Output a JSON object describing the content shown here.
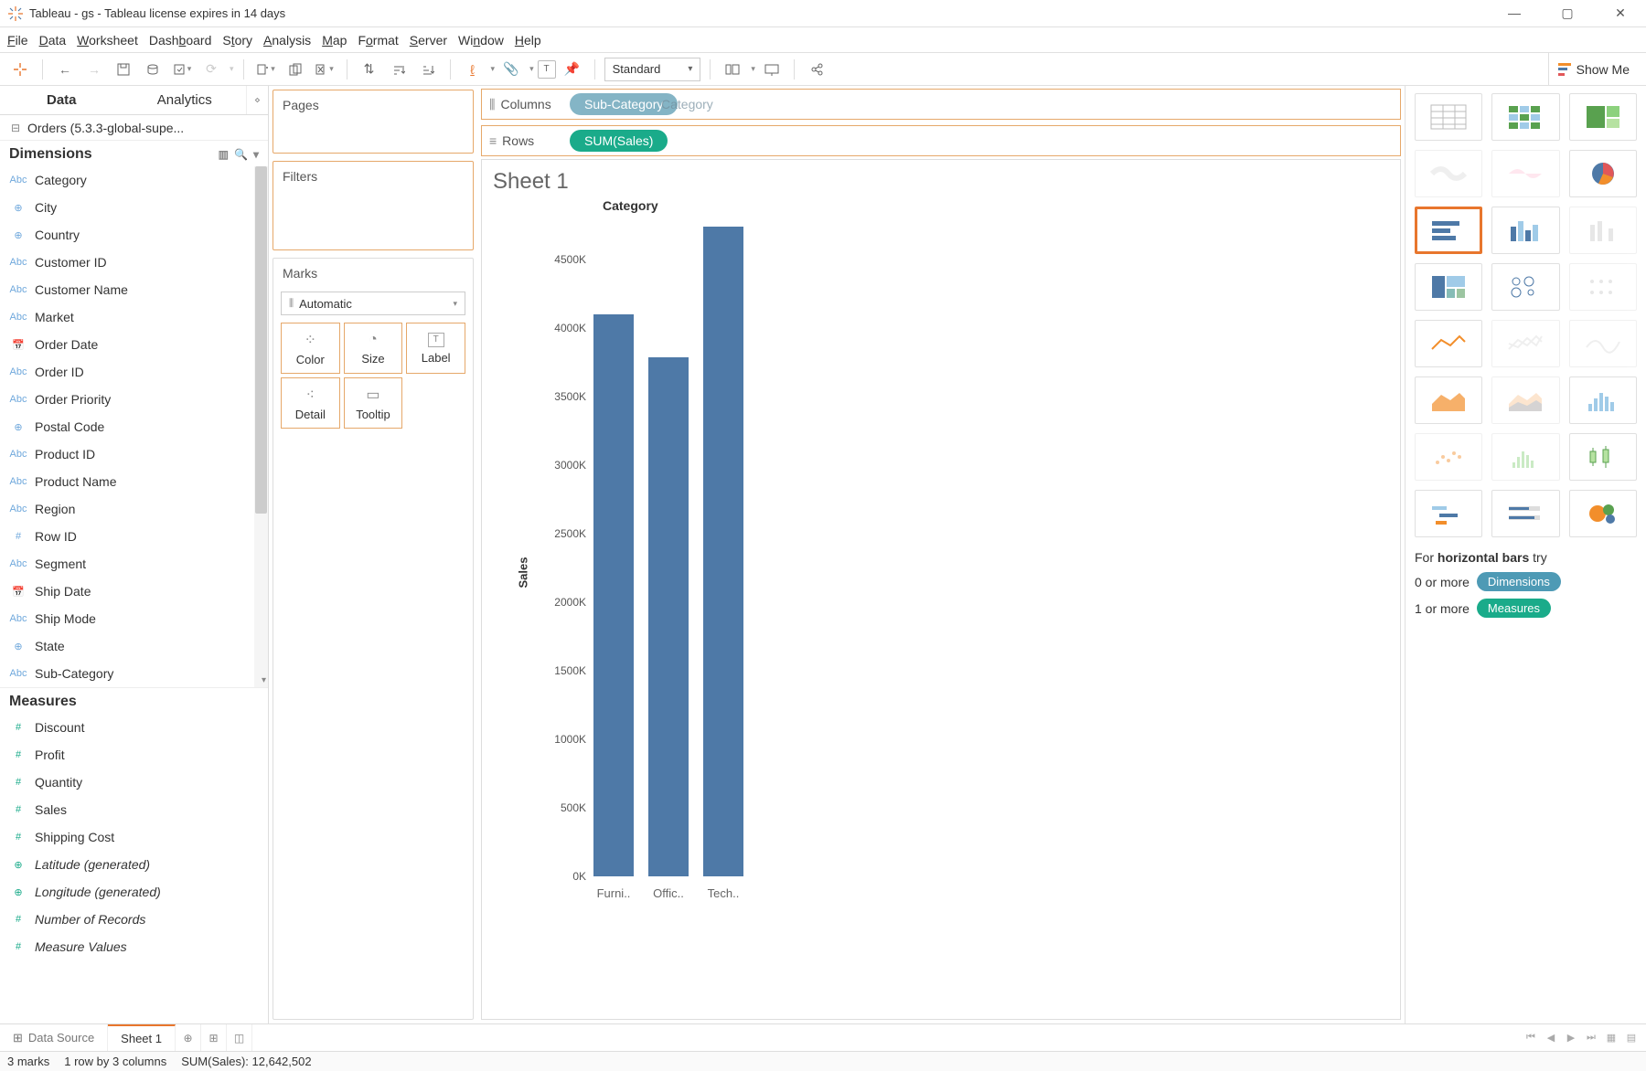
{
  "window": {
    "title": "Tableau - gs - Tableau license expires in 14 days"
  },
  "menu": [
    "File",
    "Data",
    "Worksheet",
    "Dashboard",
    "Story",
    "Analysis",
    "Map",
    "Format",
    "Server",
    "Window",
    "Help"
  ],
  "toolbar": {
    "fit": "Standard"
  },
  "showme_btn": "Show Me",
  "side": {
    "tab_data": "Data",
    "tab_analytics": "Analytics",
    "datasource": "Orders (5.3.3-global-supe...",
    "dimensions": "Dimensions",
    "measures": "Measures",
    "dim_items": [
      {
        "ico": "Abc",
        "label": "Category"
      },
      {
        "ico": "⊕",
        "label": "City"
      },
      {
        "ico": "⊕",
        "label": "Country"
      },
      {
        "ico": "Abc",
        "label": "Customer ID"
      },
      {
        "ico": "Abc",
        "label": "Customer Name"
      },
      {
        "ico": "Abc",
        "label": "Market"
      },
      {
        "ico": "📅",
        "label": "Order Date"
      },
      {
        "ico": "Abc",
        "label": "Order ID"
      },
      {
        "ico": "Abc",
        "label": "Order Priority"
      },
      {
        "ico": "⊕",
        "label": "Postal Code"
      },
      {
        "ico": "Abc",
        "label": "Product ID"
      },
      {
        "ico": "Abc",
        "label": "Product Name"
      },
      {
        "ico": "Abc",
        "label": "Region"
      },
      {
        "ico": "#",
        "label": "Row ID"
      },
      {
        "ico": "Abc",
        "label": "Segment"
      },
      {
        "ico": "📅",
        "label": "Ship Date"
      },
      {
        "ico": "Abc",
        "label": "Ship Mode"
      },
      {
        "ico": "⊕",
        "label": "State"
      },
      {
        "ico": "Abc",
        "label": "Sub-Category"
      }
    ],
    "mea_items": [
      {
        "ico": "#",
        "label": "Discount"
      },
      {
        "ico": "#",
        "label": "Profit"
      },
      {
        "ico": "#",
        "label": "Quantity"
      },
      {
        "ico": "#",
        "label": "Sales"
      },
      {
        "ico": "#",
        "label": "Shipping Cost"
      },
      {
        "ico": "⊕",
        "label": "Latitude (generated)",
        "italic": true
      },
      {
        "ico": "⊕",
        "label": "Longitude (generated)",
        "italic": true
      },
      {
        "ico": "#",
        "label": "Number of Records",
        "italic": true
      },
      {
        "ico": "#",
        "label": "Measure Values",
        "italic": true
      }
    ]
  },
  "shelves": {
    "pages": "Pages",
    "filters": "Filters",
    "marks": "Marks",
    "automatic": "Automatic",
    "marks_cells": [
      "Color",
      "Size",
      "Label",
      "Detail",
      "Tooltip"
    ],
    "columns_label": "Columns",
    "rows_label": "Rows",
    "columns_pill": "Sub-Category",
    "ghost_behind": "Category",
    "rows_pill": "SUM(Sales)"
  },
  "sheet": {
    "title": "Sheet 1",
    "axis_header": "Category",
    "y_label": "Sales"
  },
  "chart_data": {
    "type": "bar",
    "title": "Sheet 1",
    "xlabel": "Category",
    "ylabel": "Sales",
    "ylim": [
      0,
      4800000
    ],
    "y_ticks": [
      "0K",
      "500K",
      "1000K",
      "1500K",
      "2000K",
      "2500K",
      "3000K",
      "3500K",
      "4000K",
      "4500K"
    ],
    "categories": [
      "Furni..",
      "Offic..",
      "Tech.."
    ],
    "values": [
      4100000,
      3790000,
      4740000
    ]
  },
  "showme": {
    "hint_prefix": "For ",
    "hint_bold": "horizontal bars",
    "hint_suffix": " try",
    "line1_text": "0 or more",
    "line1_chip": "Dimensions",
    "line2_text": "1 or more",
    "line2_chip": "Measures"
  },
  "bottom": {
    "datasource": "Data Source",
    "sheet1": "Sheet 1"
  },
  "status": {
    "marks": "3 marks",
    "shape": "1 row by 3 columns",
    "sum": "SUM(Sales): 12,642,502"
  }
}
